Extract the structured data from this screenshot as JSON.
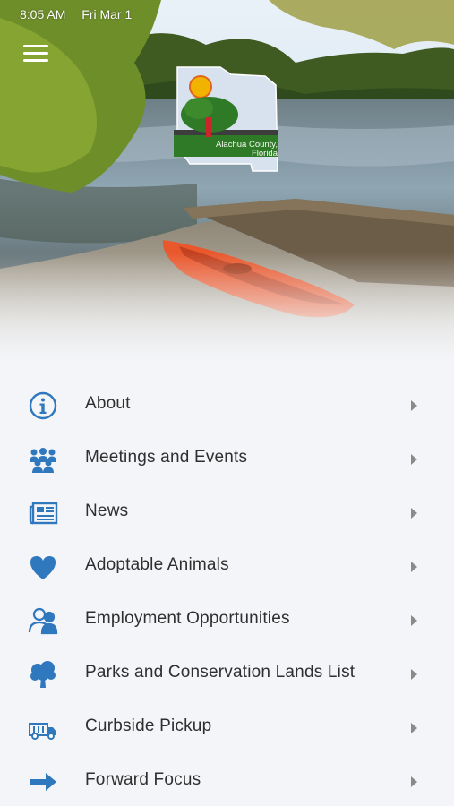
{
  "status_bar": {
    "time": "8:05 AM",
    "date": "Fri Mar 1"
  },
  "header": {
    "menu_icon": "hamburger-icon"
  },
  "logo": {
    "line1": "Alachua County,",
    "line2": "Florida"
  },
  "colors": {
    "icon_blue": "#2f78bd",
    "text": "#2f2f2f",
    "background": "#f3f5f8",
    "chevron": "#8a8a8a"
  },
  "menu": {
    "items": [
      {
        "label": "About",
        "icon": "info-icon"
      },
      {
        "label": "Meetings and Events",
        "icon": "people-group-icon"
      },
      {
        "label": "News",
        "icon": "newspaper-icon"
      },
      {
        "label": "Adoptable Animals",
        "icon": "heart-icon"
      },
      {
        "label": "Employment Opportunities",
        "icon": "employees-icon"
      },
      {
        "label": "Parks and Conservation Lands List",
        "icon": "tree-icon"
      },
      {
        "label": "Curbside Pickup",
        "icon": "garbage-truck-icon"
      },
      {
        "label": "Forward Focus",
        "icon": "arrow-right-icon"
      }
    ]
  }
}
